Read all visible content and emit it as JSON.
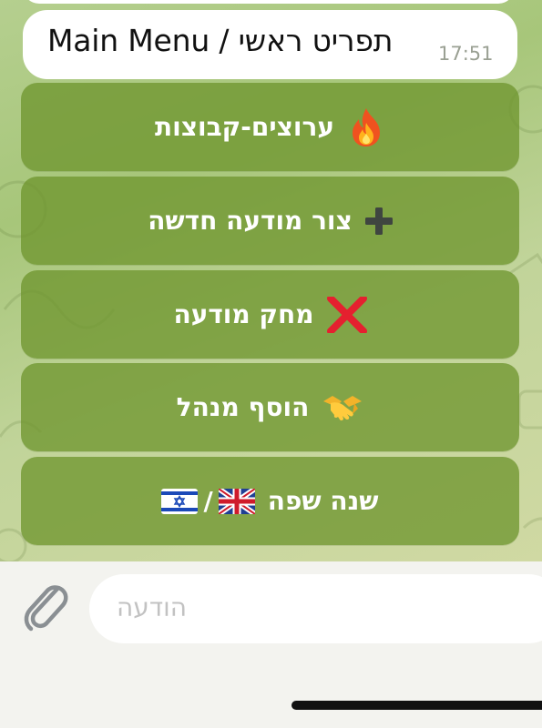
{
  "chat": {
    "message": {
      "text": "Main Menu / תפריט ראשי",
      "time": "17:51"
    }
  },
  "keyboard": {
    "buttons": [
      {
        "label": "ערוצים-קבוצות",
        "icon": "fire-icon"
      },
      {
        "label": "צור מודעה חדשה",
        "icon": "plus-icon"
      },
      {
        "label": "מחק מודעה",
        "icon": "cross-mark-icon"
      },
      {
        "label": "הוסף מנהל",
        "icon": "handshake-icon"
      },
      {
        "label": "שנה שפה",
        "suffix": "/",
        "icons": [
          "uk-flag-icon",
          "israel-flag-icon"
        ]
      }
    ]
  },
  "composer": {
    "placeholder": "הודעה",
    "attach_icon": "paperclip-icon"
  },
  "colors": {
    "button_fill": "#7a9a32",
    "chat_background": "#b5cf8f",
    "bubble": "#ffffff"
  }
}
